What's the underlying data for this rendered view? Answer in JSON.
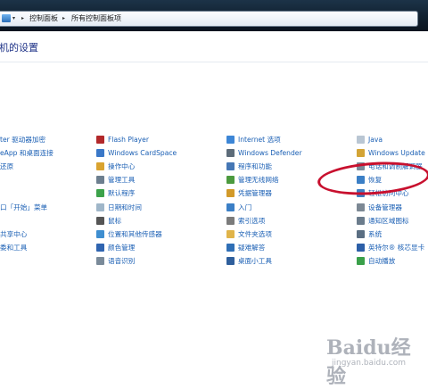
{
  "address_bar": {
    "crumbs": [
      "控制面板",
      "所有控制面板项"
    ]
  },
  "page_title": "机的设置",
  "columns": [
    {
      "items": [
        {
          "label": "ter 驱动器加密",
          "icon": "bitlocker-icon"
        },
        {
          "label": "eApp 和桌面连接",
          "icon": "remoteapp-icon"
        },
        {
          "label": "还原",
          "icon": "restore-icon"
        },
        {
          "label": "",
          "icon": ""
        },
        {
          "label": "",
          "icon": ""
        },
        {
          "label": "口「开始」菜单",
          "icon": "start-menu-icon"
        },
        {
          "label": "",
          "icon": ""
        },
        {
          "label": "共享中心",
          "icon": "network-sharing-icon"
        },
        {
          "label": "委和工具",
          "icon": "performance-icon"
        }
      ]
    },
    {
      "items": [
        {
          "label": "Flash Player",
          "icon": "flash-icon",
          "color": "#b2282a"
        },
        {
          "label": "Windows CardSpace",
          "icon": "cardspace-icon",
          "color": "#3a78c8"
        },
        {
          "label": "操作中心",
          "icon": "action-center-icon",
          "color": "#d9a330"
        },
        {
          "label": "管理工具",
          "icon": "admin-tools-icon",
          "color": "#6d7f8f"
        },
        {
          "label": "默认程序",
          "icon": "default-programs-icon",
          "color": "#3ca24a"
        },
        {
          "label": "日期和时间",
          "icon": "clock-icon",
          "color": "#9fb6c9"
        },
        {
          "label": "鼠标",
          "icon": "mouse-icon",
          "color": "#555555"
        },
        {
          "label": "位置和其他传感器",
          "icon": "sensor-icon",
          "color": "#3e8ed0"
        },
        {
          "label": "颜色管理",
          "icon": "color-management-icon",
          "color": "#2f64b0"
        },
        {
          "label": "语音识别",
          "icon": "microphone-icon",
          "color": "#7a8a99"
        }
      ]
    },
    {
      "items": [
        {
          "label": "Internet 选项",
          "icon": "internet-options-icon",
          "color": "#3d86d6"
        },
        {
          "label": "Windows Defender",
          "icon": "defender-icon",
          "color": "#5d6c7a"
        },
        {
          "label": "程序和功能",
          "icon": "programs-icon",
          "color": "#4577b5"
        },
        {
          "label": "管理无线网络",
          "icon": "wireless-icon",
          "color": "#4c9a3e"
        },
        {
          "label": "凭据管理器",
          "icon": "credential-icon",
          "color": "#d29a2a"
        },
        {
          "label": "入门",
          "icon": "getting-started-icon",
          "color": "#3b7fc6"
        },
        {
          "label": "索引选项",
          "icon": "indexing-icon",
          "color": "#7b7b7b"
        },
        {
          "label": "文件夹选项",
          "icon": "folder-options-icon",
          "color": "#e0b44a"
        },
        {
          "label": "疑难解答",
          "icon": "troubleshooting-icon",
          "color": "#2f6fb6"
        },
        {
          "label": "桌面小工具",
          "icon": "gadgets-icon",
          "color": "#2f5f9c"
        }
      ]
    },
    {
      "items": [
        {
          "label": "Java",
          "icon": "java-icon",
          "color": "#b9c6d3"
        },
        {
          "label": "Windows Update",
          "icon": "windows-update-icon",
          "color": "#d3a436"
        },
        {
          "label": "电话和调制解调器",
          "icon": "phone-modem-icon",
          "color": "#7a8a99"
        },
        {
          "label": "恢复",
          "icon": "recovery-icon",
          "color": "#3b7fc6"
        },
        {
          "label": "轻松访问中心",
          "icon": "ease-of-access-icon",
          "color": "#3c7ec4"
        },
        {
          "label": "设备管理器",
          "icon": "device-manager-icon",
          "color": "#7c8894"
        },
        {
          "label": "通知区域图标",
          "icon": "notification-area-icon",
          "color": "#6b7c8c"
        },
        {
          "label": "系统",
          "icon": "system-icon",
          "color": "#5a6e82"
        },
        {
          "label": "英特尔® 核芯显卡",
          "icon": "intel-graphics-icon",
          "color": "#2c5fa8"
        },
        {
          "label": "自动播放",
          "icon": "autoplay-icon",
          "color": "#3aa04a"
        }
      ]
    }
  ],
  "watermark": {
    "main": "Baidu经验",
    "sub": "jingyan.baidu.com"
  },
  "highlight_color": "#c8102e"
}
